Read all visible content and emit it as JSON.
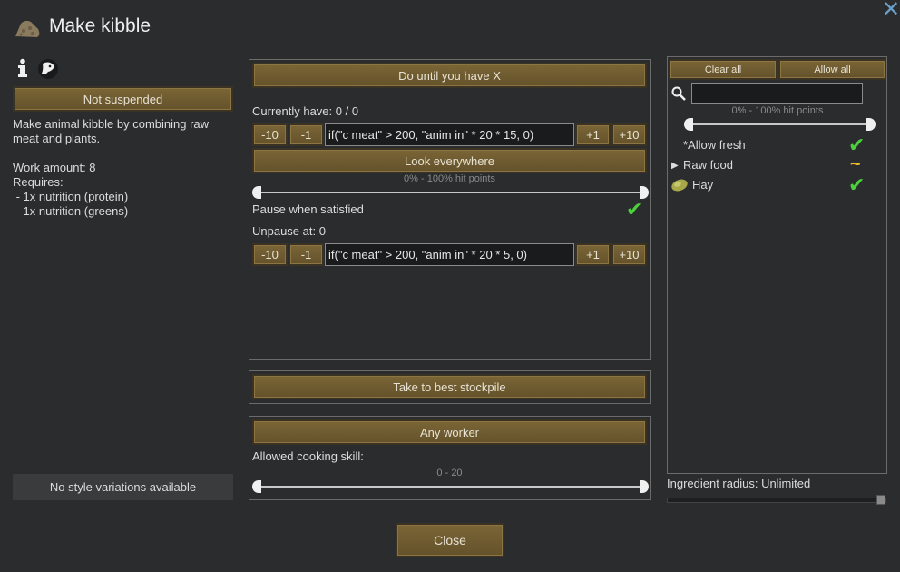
{
  "window": {
    "title": "Make kibble",
    "close_glyph": "✕"
  },
  "left": {
    "suspend_button": "Not suspended",
    "description_line1": "Make animal kibble by combining raw",
    "description_line2": "meat and plants.",
    "work_amount": "Work amount: 8",
    "requires_label": "Requires:",
    "requires": [
      " - 1x nutrition (protein)",
      " - 1x nutrition (greens)"
    ],
    "style_variations": "No style variations available"
  },
  "bill": {
    "mode_button": "Do until you have X",
    "currently_have": "Currently have: 0 / 0",
    "minus10": "-10",
    "minus1": "-1",
    "plus1": "+1",
    "plus10": "+10",
    "target_expr": "if(\"c meat\" > 200, \"anim in\" * 20 * 15, 0)",
    "look_button": "Look everywhere",
    "hp_range": "0% - 100% hit points",
    "pause_when_satisfied": "Pause when satisfied",
    "unpause_at": "Unpause at: 0",
    "unpause_expr": "if(\"c meat\" > 200, \"anim in\" * 20 * 5, 0)"
  },
  "store": {
    "stockpile_button": "Take to best stockpile"
  },
  "worker": {
    "worker_button": "Any worker",
    "skill_label": "Allowed cooking skill:",
    "skill_range": "0 - 20"
  },
  "filter": {
    "clear_all": "Clear all",
    "allow_all": "Allow all",
    "search_value": "",
    "hp_range": "0% - 100% hit points",
    "items": [
      {
        "label": "*Allow fresh",
        "state": "check"
      },
      {
        "label": "Raw food",
        "state": "partial"
      },
      {
        "label": "Hay",
        "state": "check"
      }
    ],
    "ingredient_radius": "Ingredient radius: Unlimited"
  },
  "footer": {
    "close_button": "Close"
  },
  "colors": {
    "button": "#6f5c31",
    "check": "#4cd03c",
    "partial": "#e8b830"
  }
}
